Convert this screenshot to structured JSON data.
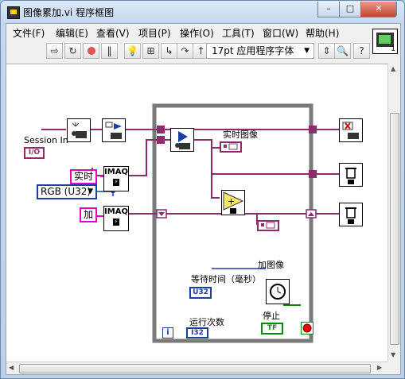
{
  "window": {
    "title": "图像累加.vi 程序框图",
    "minimize": "–",
    "maximize": "□",
    "close": "✕"
  },
  "menu": [
    "文件(F)",
    "编辑(E)",
    "查看(V)",
    "项目(P)",
    "操作(O)",
    "工具(T)",
    "窗口(W)",
    "帮助(H)"
  ],
  "toolbar": {
    "icons": [
      "run-arrow-icon",
      "run-continuous-icon",
      "abort-icon",
      "pause-icon",
      "highlight-execution-icon",
      "retain-wire-values-icon",
      "step-into-icon",
      "step-over-icon",
      "step-out-icon",
      "align-icon",
      "zoom-icon",
      "help-icon"
    ],
    "font_select": "17pt 应用程序字体"
  },
  "vi_icon": {
    "number": "1"
  },
  "diagram": {
    "session_in_label": "Session In",
    "session_terminal": "I/O",
    "rgb_constant": "RGB (U32)",
    "realtime_string": "实时",
    "add_string": "加",
    "imaq_label_1": "IMAQ",
    "imaq_label_2": "IMAQ",
    "realtime_image_label": "实时图像",
    "add_image_label": "加图像",
    "wait_label": "等待时间（毫秒）",
    "wait_terminal": "U32",
    "stop_label": "停止",
    "stop_terminal": "TF",
    "loop_count_label": "运行次数",
    "loop_count_terminal": "I32",
    "iteration_terminal": "i"
  },
  "colors": {
    "image_wire": "#8b2c6b",
    "session_wire": "#8b2c6b",
    "loop_border": "#7a7a7a",
    "numeric_blue": "#1b3fa0",
    "boolean_green": "#0a8a0a",
    "string_pink": "#e000c8"
  }
}
